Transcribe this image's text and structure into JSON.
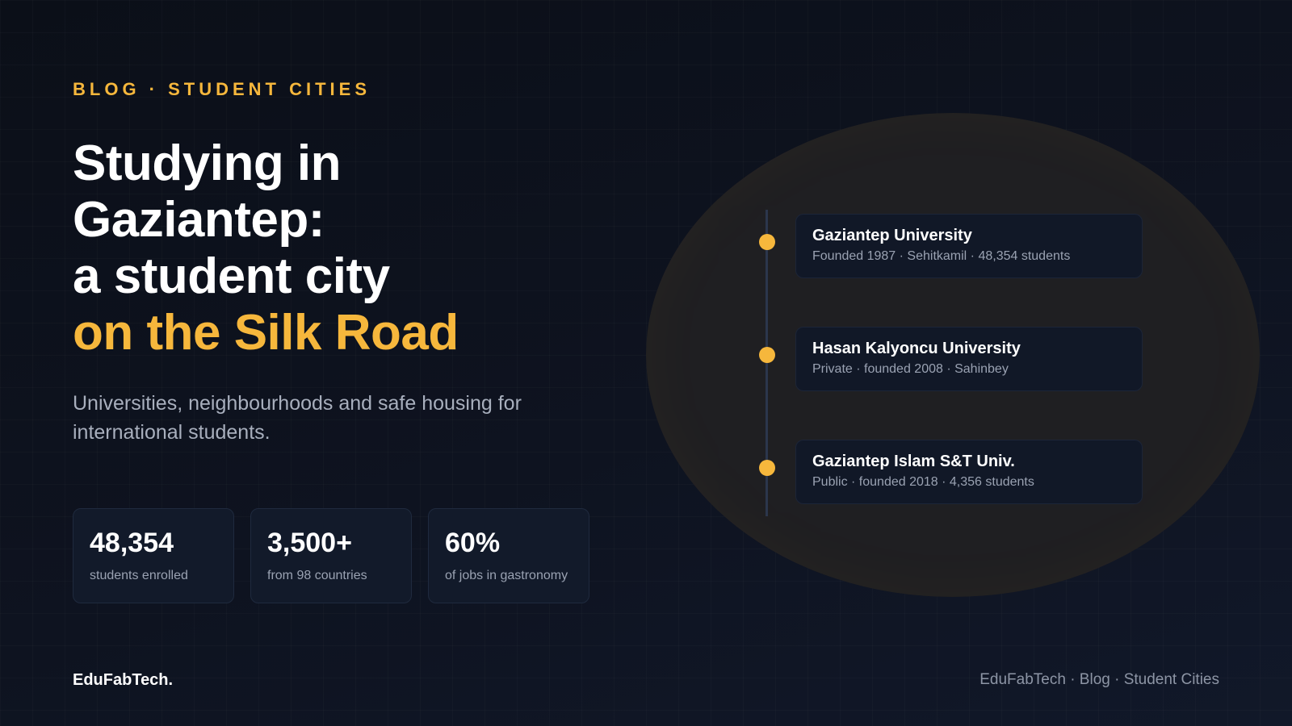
{
  "eyebrow": "BLOG · STUDENT CITIES",
  "headline": {
    "line1": "Studying in",
    "line2": "Gaziantep:",
    "line3": "a student city",
    "line4": "on the Silk Road"
  },
  "subtitle": "Universities, neighbourhoods and safe housing for international students.",
  "stats": [
    {
      "value": "48,354",
      "label": "students enrolled"
    },
    {
      "value": "3,500+",
      "label": "from 98 countries"
    },
    {
      "value": "60%",
      "label": "of jobs in gastronomy"
    }
  ],
  "universities": [
    {
      "name": "Gaziantep University",
      "meta": "Founded 1987 · Sehitkamil · 48,354 students"
    },
    {
      "name": "Hasan Kalyoncu University",
      "meta": "Private · founded 2008 · Sahinbey"
    },
    {
      "name": "Gaziantep Islam S&T Univ.",
      "meta": "Public · founded 2018 · 4,356 students"
    }
  ],
  "footer": {
    "brand": "EduFabTech.",
    "breadcrumb": "EduFabTech · Blog · Student Cities"
  },
  "colors": {
    "accent": "#f6b73c",
    "background": "#0c101a",
    "card": "#121a2a"
  }
}
